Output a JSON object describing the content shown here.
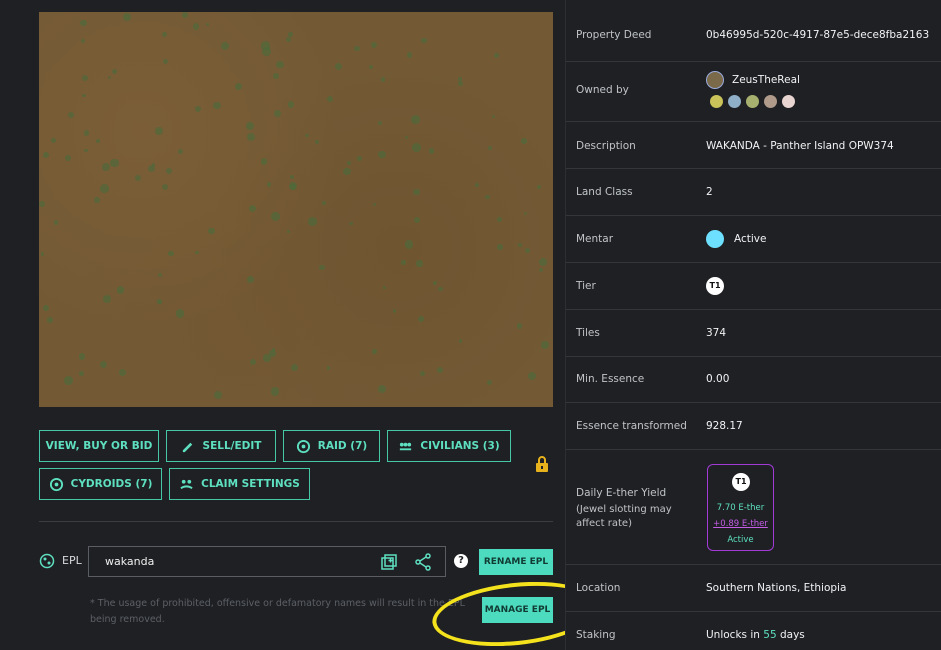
{
  "actions": {
    "view_buy_bid": "VIEW, BUY OR BID",
    "sell_edit": "SELL/EDIT",
    "raid": "RAID (7)",
    "civilians": "CIVILIANS (3)",
    "cydroids": "CYDROIDS (7)",
    "claim_settings": "CLAIM SETTINGS"
  },
  "epl": {
    "label": "EPL",
    "value": "wakanda",
    "rename_label": "RENAME EPL",
    "manage_label": "MANAGE EPL",
    "note": "* The usage of prohibited, offensive or defamatory names will result in the EPL being removed."
  },
  "details": {
    "property_deed": {
      "key": "Property Deed",
      "value": "0b46995d-520c-4917-87e5-dece8fba2163"
    },
    "owned_by": {
      "key": "Owned by",
      "value": "ZeusTheReal"
    },
    "description": {
      "key": "Description",
      "value": "WAKANDA - Panther Island OPW374"
    },
    "land_class": {
      "key": "Land Class",
      "value": "2"
    },
    "mentar": {
      "key": "Mentar",
      "value": "Active"
    },
    "tier": {
      "key": "Tier",
      "value": "T1"
    },
    "tiles": {
      "key": "Tiles",
      "value": "374"
    },
    "min_essence": {
      "key": "Min. Essence",
      "value": "0.00"
    },
    "essence_transformed": {
      "key": "Essence transformed",
      "value": "928.17"
    },
    "daily_yield": {
      "key": "Daily E-ther Yield",
      "subkey": "(Jewel slotting may affect rate)",
      "tier": "T1",
      "base": "7.70 E-ther",
      "bonus": "+0.89 E-ther",
      "status": "Active"
    },
    "location": {
      "key": "Location",
      "value": "Southern Nations, Ethiopia"
    },
    "staking": {
      "key": "Staking",
      "value_prefix": "Unlocks in",
      "value_days": "55",
      "value_suffix": "days"
    }
  },
  "colors": {
    "accent": "#4cdbbf",
    "highlight": "#f4e21d",
    "yield_border": "#a23bd6",
    "bonus": "#c45ce6"
  }
}
